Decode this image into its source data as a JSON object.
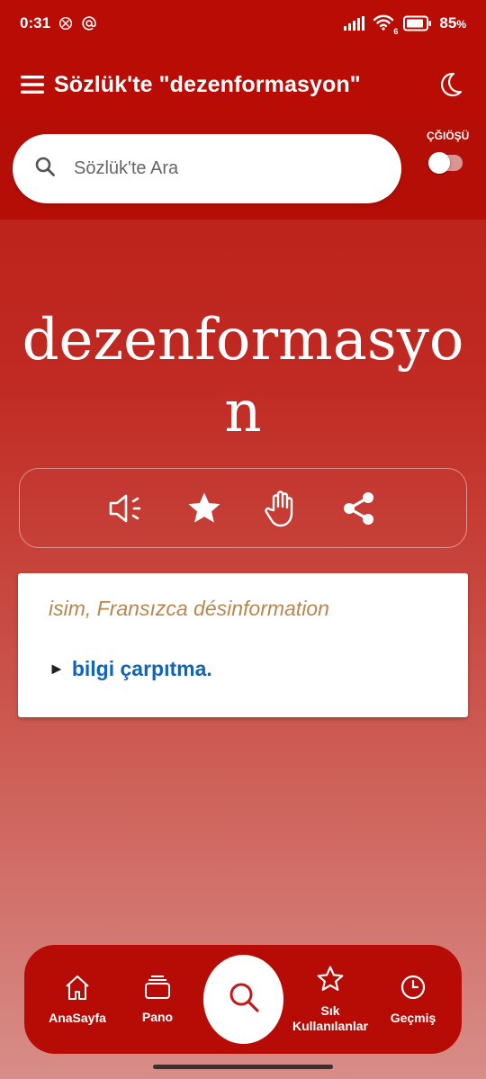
{
  "status_bar": {
    "time": "0:31",
    "battery": "85",
    "battery_unit": "%",
    "wifi_badge": "6",
    "icons": [
      "openai-icon",
      "at-sign-icon",
      "signal-icon",
      "wifi-icon",
      "battery-icon"
    ]
  },
  "header": {
    "title": "Sözlük'te \"dezenformasyon\"",
    "icons": [
      "hamburger-menu-icon",
      "moon-icon"
    ]
  },
  "search": {
    "placeholder": "Sözlük'te Ara",
    "char_toggle_label": "ÇĞIÖŞÜ",
    "char_toggle_on": false
  },
  "entry": {
    "headword": "dezenformasyon",
    "actions": [
      "speaker-icon",
      "star-icon",
      "hand-icon",
      "share-icon"
    ],
    "origin": "isim, Fransızca désinformation",
    "meaning_marker": "►",
    "meaning": "bilgi çarpıtma."
  },
  "bottom_nav": {
    "items": [
      {
        "label": "AnaSayfa",
        "icon": "home-icon"
      },
      {
        "label": "Pano",
        "icon": "stack-icon"
      },
      {
        "label": "",
        "icon": "search-icon"
      },
      {
        "label": "Sık Kullanılanlar",
        "icon": "star-outline-icon"
      },
      {
        "label": "Geçmiş",
        "icon": "clock-icon"
      }
    ]
  },
  "colors": {
    "brand_red": "#b80c05",
    "origin_text": "#b8864f",
    "meaning_link": "#1464b4"
  }
}
